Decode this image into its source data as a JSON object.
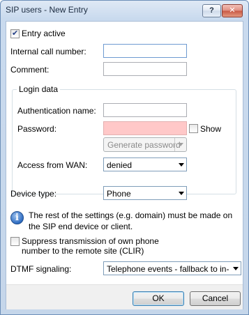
{
  "window": {
    "title": "SIP users - New Entry",
    "help_glyph": "?",
    "close_glyph": "✕"
  },
  "form": {
    "entry_active": {
      "label": "Entry active",
      "checked": true
    },
    "internal_call_number": {
      "label": "Internal call number:",
      "value": ""
    },
    "comment": {
      "label": "Comment:",
      "value": ""
    },
    "login_data": {
      "title": "Login data",
      "authentication_name": {
        "label": "Authentication name:",
        "value": ""
      },
      "password": {
        "label": "Password:",
        "value": ""
      },
      "show": {
        "label": "Show",
        "checked": false
      },
      "generate_password_label": "Generate password",
      "access_from_wan": {
        "label": "Access from WAN:",
        "value": "denied"
      }
    },
    "device_type": {
      "label": "Device type:",
      "value": "Phone"
    },
    "info_text": "The rest of the settings (e.g. domain) must be made on the SIP end device or client.",
    "info_icon_glyph": "i",
    "suppress_clir": {
      "label": "Suppress transmission of own phone number to the remote site (CLIR)",
      "checked": false
    },
    "dtmf_signaling": {
      "label": "DTMF signaling:",
      "value": "Telephone events - fallback to in-band"
    }
  },
  "buttons": {
    "ok_label": "OK",
    "cancel_label": "Cancel"
  },
  "colors": {
    "password_bg": "#ffc8c8",
    "title_bar": "#c9daee"
  }
}
